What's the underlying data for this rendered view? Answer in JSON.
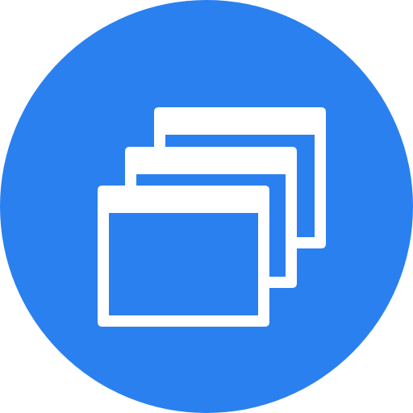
{
  "icon": {
    "name": "multiple-windows-icon",
    "background_color": "#2a80ef",
    "foreground_color": "#ffffff",
    "window_count": 3
  }
}
